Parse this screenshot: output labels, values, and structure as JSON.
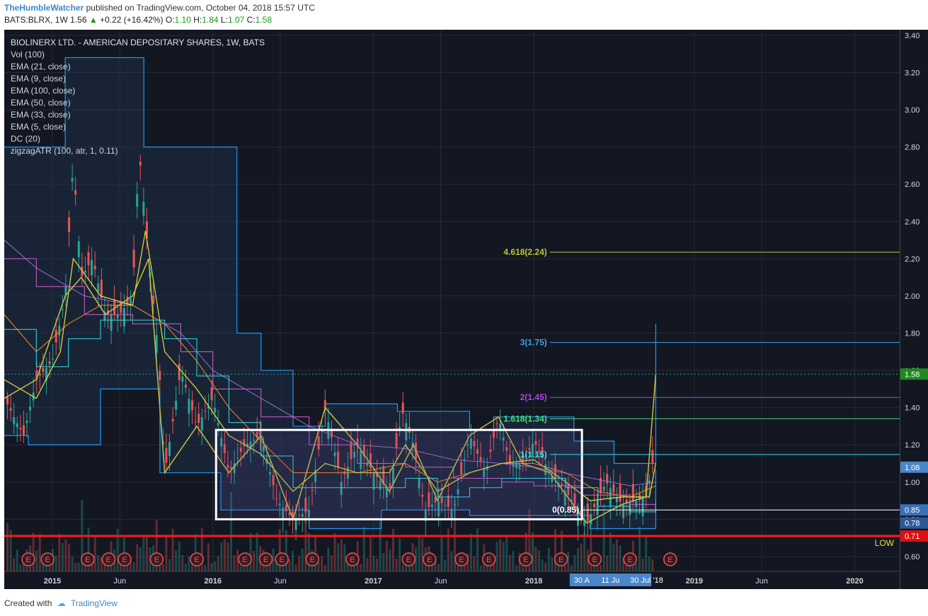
{
  "header": {
    "author": "TheHumbleWatcher",
    "published": "published on TradingView.com, October 04, 2018 15:57 UTC",
    "symbol": "BATS:BLRX, 1W",
    "last": "1.56",
    "change_arrow": "▲",
    "change": "+0.22 (+16.42%)",
    "o_label": "O:",
    "o": "1.10",
    "h_label": "H:",
    "h": "1.84",
    "l_label": "L:",
    "l": "1.07",
    "c_label": "C:",
    "c": "1.58"
  },
  "legend": {
    "title": "BIOLINERX LTD. - AMERICAN DEPOSITARY SHARES, 1W, BATS",
    "items": [
      "Vol (100)",
      "EMA (21, close)",
      "EMA (9, close)",
      "EMA (100, close)",
      "EMA (50, close)",
      "EMA (33, close)",
      "EMA (5, close)",
      "DC (20)",
      "zigzagATR (100, atr, 1, 0.11)"
    ]
  },
  "footer": {
    "created_with": "Created with",
    "brand": "TradingView"
  },
  "colors": {
    "bg": "#131722",
    "grid": "#2a2e39",
    "up": "#26a69a",
    "down": "#ef5350",
    "dc": "#2196f3"
  },
  "chart_data": {
    "type": "candlestick",
    "ylim": [
      0.52,
      3.43
    ],
    "y_ticks": [
      0.6,
      0.8,
      1.0,
      1.2,
      1.4,
      1.6,
      1.8,
      2.0,
      2.2,
      2.4,
      2.6,
      2.8,
      3.0,
      3.2,
      3.4
    ],
    "x_ticks": [
      {
        "label": "2015",
        "t": 2015.0
      },
      {
        "label": "Jun",
        "t": 2015.42
      },
      {
        "label": "2016",
        "t": 2016.0
      },
      {
        "label": "Jun",
        "t": 2016.42
      },
      {
        "label": "2017",
        "t": 2017.0
      },
      {
        "label": "Jun",
        "t": 2017.42
      },
      {
        "label": "2018",
        "t": 2018.0
      },
      {
        "label": "2019",
        "t": 2019.0
      },
      {
        "label": "Jun",
        "t": 2019.42
      },
      {
        "label": "2020",
        "t": 2020.0
      }
    ],
    "x_range": [
      2014.7,
      2020.28
    ],
    "price_path": [
      [
        2014.7,
        1.45
      ],
      [
        2014.82,
        1.25
      ],
      [
        2014.9,
        1.55
      ],
      [
        2015.0,
        1.65
      ],
      [
        2015.08,
        2.0
      ],
      [
        2015.13,
        2.72
      ],
      [
        2015.18,
        2.1
      ],
      [
        2015.25,
        2.2
      ],
      [
        2015.33,
        1.9
      ],
      [
        2015.42,
        1.9
      ],
      [
        2015.5,
        2.0
      ],
      [
        2015.54,
        2.78
      ],
      [
        2015.6,
        2.2
      ],
      [
        2015.66,
        1.7
      ],
      [
        2015.7,
        1.05
      ],
      [
        2015.8,
        1.6
      ],
      [
        2015.9,
        1.3
      ],
      [
        2016.0,
        1.45
      ],
      [
        2016.1,
        1.05
      ],
      [
        2016.2,
        1.2
      ],
      [
        2016.3,
        1.25
      ],
      [
        2016.4,
        0.9
      ],
      [
        2016.5,
        0.8
      ],
      [
        2016.6,
        0.85
      ],
      [
        2016.7,
        1.4
      ],
      [
        2016.8,
        1.0
      ],
      [
        2016.9,
        1.2
      ],
      [
        2017.0,
        1.05
      ],
      [
        2017.1,
        0.95
      ],
      [
        2017.18,
        1.38
      ],
      [
        2017.25,
        1.2
      ],
      [
        2017.32,
        0.85
      ],
      [
        2017.4,
        0.9
      ],
      [
        2017.5,
        0.85
      ],
      [
        2017.6,
        1.25
      ],
      [
        2017.7,
        1.05
      ],
      [
        2017.78,
        1.35
      ],
      [
        2017.85,
        1.1
      ],
      [
        2017.93,
        1.1
      ],
      [
        2018.0,
        1.22
      ],
      [
        2018.1,
        1.05
      ],
      [
        2018.2,
        0.95
      ],
      [
        2018.33,
        0.78
      ],
      [
        2018.45,
        1.0
      ],
      [
        2018.55,
        0.88
      ],
      [
        2018.65,
        0.9
      ],
      [
        2018.7,
        0.92
      ],
      [
        2018.74,
        1.1
      ],
      [
        2018.76,
        1.58
      ]
    ],
    "donchian_upper": [
      [
        2014.7,
        2.8
      ],
      [
        2015.0,
        2.8
      ],
      [
        2015.08,
        3.28
      ],
      [
        2015.5,
        3.28
      ],
      [
        2015.57,
        2.8
      ],
      [
        2015.95,
        2.8
      ],
      [
        2016.0,
        2.8
      ],
      [
        2016.15,
        1.8
      ],
      [
        2016.3,
        1.6
      ],
      [
        2016.5,
        1.3
      ],
      [
        2016.7,
        1.42
      ],
      [
        2017.1,
        1.42
      ],
      [
        2017.15,
        1.38
      ],
      [
        2017.5,
        1.38
      ],
      [
        2017.6,
        1.28
      ],
      [
        2017.75,
        1.35
      ],
      [
        2018.2,
        1.35
      ],
      [
        2018.25,
        1.22
      ],
      [
        2018.5,
        1.1
      ],
      [
        2018.72,
        1.1
      ],
      [
        2018.76,
        1.85
      ]
    ],
    "donchian_lower": [
      [
        2014.7,
        1.25
      ],
      [
        2014.85,
        1.2
      ],
      [
        2015.2,
        1.2
      ],
      [
        2015.3,
        1.5
      ],
      [
        2015.6,
        1.5
      ],
      [
        2015.67,
        1.05
      ],
      [
        2016.0,
        1.05
      ],
      [
        2016.05,
        0.85
      ],
      [
        2016.5,
        0.85
      ],
      [
        2016.6,
        0.75
      ],
      [
        2016.95,
        0.75
      ],
      [
        2017.05,
        0.85
      ],
      [
        2017.5,
        0.85
      ],
      [
        2017.6,
        0.82
      ],
      [
        2018.3,
        0.82
      ],
      [
        2018.35,
        0.75
      ],
      [
        2018.72,
        0.75
      ],
      [
        2018.76,
        1.07
      ]
    ],
    "ema_fast": [
      [
        2014.7,
        1.55
      ],
      [
        2014.9,
        1.45
      ],
      [
        2015.05,
        1.7
      ],
      [
        2015.13,
        2.2
      ],
      [
        2015.3,
        2.0
      ],
      [
        2015.5,
        1.95
      ],
      [
        2015.58,
        2.35
      ],
      [
        2015.7,
        1.7
      ],
      [
        2015.9,
        1.5
      ],
      [
        2016.1,
        1.25
      ],
      [
        2016.3,
        1.15
      ],
      [
        2016.5,
        0.95
      ],
      [
        2016.7,
        1.1
      ],
      [
        2016.9,
        1.05
      ],
      [
        2017.1,
        1.05
      ],
      [
        2017.2,
        1.2
      ],
      [
        2017.4,
        0.95
      ],
      [
        2017.6,
        1.05
      ],
      [
        2017.8,
        1.1
      ],
      [
        2018.0,
        1.12
      ],
      [
        2018.2,
        1.0
      ],
      [
        2018.35,
        0.9
      ],
      [
        2018.55,
        0.92
      ],
      [
        2018.72,
        0.92
      ],
      [
        2018.76,
        1.1
      ]
    ],
    "ema_slow": [
      [
        2014.7,
        2.3
      ],
      [
        2014.9,
        2.15
      ],
      [
        2015.2,
        2.0
      ],
      [
        2015.5,
        1.95
      ],
      [
        2015.8,
        1.8
      ],
      [
        2016.0,
        1.6
      ],
      [
        2016.3,
        1.45
      ],
      [
        2016.6,
        1.3
      ],
      [
        2016.9,
        1.2
      ],
      [
        2017.2,
        1.18
      ],
      [
        2017.5,
        1.12
      ],
      [
        2017.8,
        1.1
      ],
      [
        2018.0,
        1.08
      ],
      [
        2018.3,
        1.03
      ],
      [
        2018.6,
        0.98
      ],
      [
        2018.76,
        1.0
      ]
    ],
    "ema_mid": [
      [
        2014.7,
        1.9
      ],
      [
        2014.9,
        1.7
      ],
      [
        2015.1,
        1.85
      ],
      [
        2015.3,
        1.95
      ],
      [
        2015.5,
        1.95
      ],
      [
        2015.7,
        1.85
      ],
      [
        2015.9,
        1.65
      ],
      [
        2016.1,
        1.4
      ],
      [
        2016.3,
        1.22
      ],
      [
        2016.5,
        1.05
      ],
      [
        2016.7,
        1.05
      ],
      [
        2016.9,
        1.05
      ],
      [
        2017.2,
        1.1
      ],
      [
        2017.4,
        1.0
      ],
      [
        2017.6,
        1.05
      ],
      [
        2017.8,
        1.1
      ],
      [
        2018.0,
        1.1
      ],
      [
        2018.2,
        1.05
      ],
      [
        2018.4,
        0.95
      ],
      [
        2018.6,
        0.92
      ],
      [
        2018.76,
        0.98
      ]
    ],
    "fib_levels": [
      {
        "label": "4.618(2.24)",
        "value": 2.235,
        "color": "#b7c53a"
      },
      {
        "label": "3(1.75)",
        "value": 1.75,
        "color": "#3aa0e8"
      },
      {
        "label": "2(1.45)",
        "value": 1.455,
        "color": "#b044e0"
      },
      {
        "label": "1.618(1.34)",
        "value": 1.34,
        "color": "#3fe07a"
      },
      {
        "label": "1(1.15)",
        "value": 1.148,
        "color": "#2ee0e8"
      },
      {
        "label": "0(0.85)",
        "value": 0.85,
        "color": "#ffffff"
      }
    ],
    "support": {
      "label": "LOW",
      "value": 0.71,
      "color": "#ff1a1a"
    },
    "range_box": {
      "t0": 2016.02,
      "t1": 2018.3,
      "y0": 0.8,
      "y1": 1.28
    },
    "price_labels": [
      {
        "label": "3.40",
        "value": 3.4
      },
      {
        "label": "1.58",
        "value": 1.58,
        "bg": "#1e8a1e"
      },
      {
        "label": "1.08",
        "value": 1.08,
        "bg": "#4a86c8"
      },
      {
        "label": "0.85",
        "value": 0.85,
        "bg": "#3a70b8"
      },
      {
        "label": "0.78",
        "value": 0.78,
        "bg": "#2a5a98"
      },
      {
        "label": "0.71",
        "value": 0.71,
        "bg": "#e01010"
      }
    ],
    "earnings_markers": {
      "label": "E",
      "t": [
        2014.85,
        2014.97,
        2015.22,
        2015.35,
        2015.45,
        2015.65,
        2015.9,
        2016.2,
        2016.33,
        2016.43,
        2016.62,
        2016.87,
        2017.22,
        2017.35,
        2017.55,
        2017.72,
        2017.95,
        2018.17,
        2018.38,
        2018.6,
        2018.85
      ]
    },
    "date_tags": {
      "labels": [
        "30 A",
        "11 Ju",
        "30 Jul '18"
      ],
      "t": [
        2018.25,
        2018.42,
        2018.6
      ]
    }
  }
}
